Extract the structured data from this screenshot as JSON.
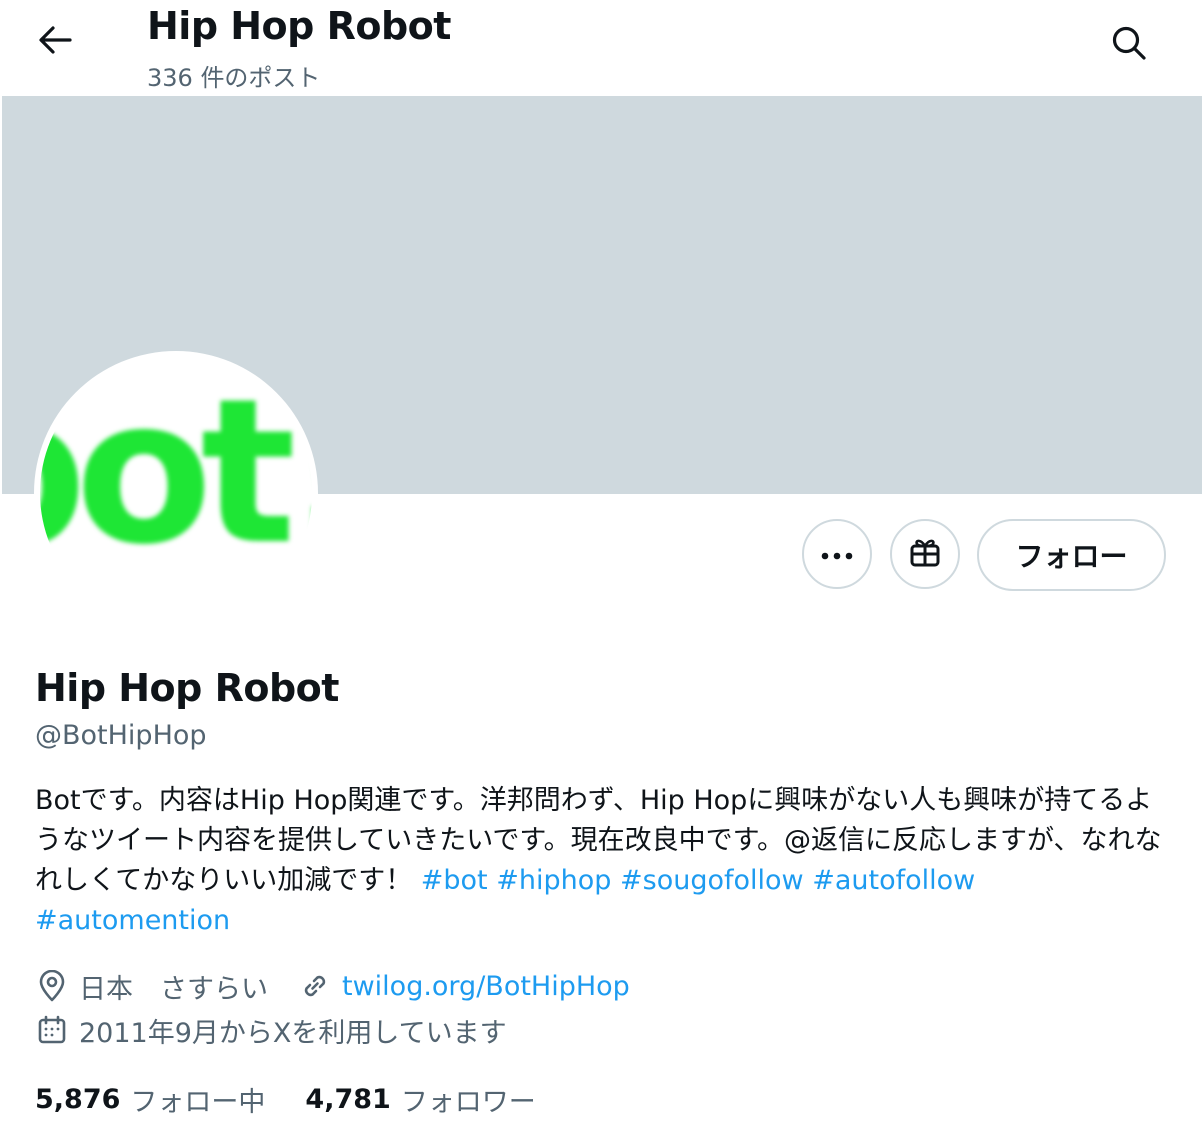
{
  "header": {
    "title": "Hip Hop Robot",
    "post_count": "336 件のポスト",
    "back_icon": "arrow-left-icon",
    "search_icon": "search-icon"
  },
  "banner": {
    "color": "#cfd9de"
  },
  "avatar": {
    "logo_text": "bot!",
    "logo_color": "#1ee635"
  },
  "actions": {
    "more_icon": "more-dots-icon",
    "gift_icon": "gift-icon",
    "follow_label": "フォロー"
  },
  "profile": {
    "name": "Hip Hop Robot",
    "handle": "@BotHipHop",
    "bio_text": "Botです。内容はHip Hop関連です。洋邦問わず、Hip Hopに興味がない人も興味が持てるようなツイート内容を提供していきたいです。現在改良中です。@返信に反応しますが、なれなれしくてかなりいい加減です！ ",
    "hashtags": [
      "#bot",
      "#hiphop",
      "#sougofollow",
      "#autofollow",
      "#automention"
    ],
    "location": "日本　さすらい",
    "website": "twilog.org/BotHipHop",
    "joined": "2011年9月からXを利用しています"
  },
  "stats": {
    "following_count": "5,876",
    "following_label": "フォロー中",
    "followers_count": "4,781",
    "followers_label": "フォロワー"
  },
  "colors": {
    "link": "#1d9bf0",
    "secondary_text": "#536471",
    "primary_text": "#0f1419",
    "border": "#cfd9de"
  }
}
